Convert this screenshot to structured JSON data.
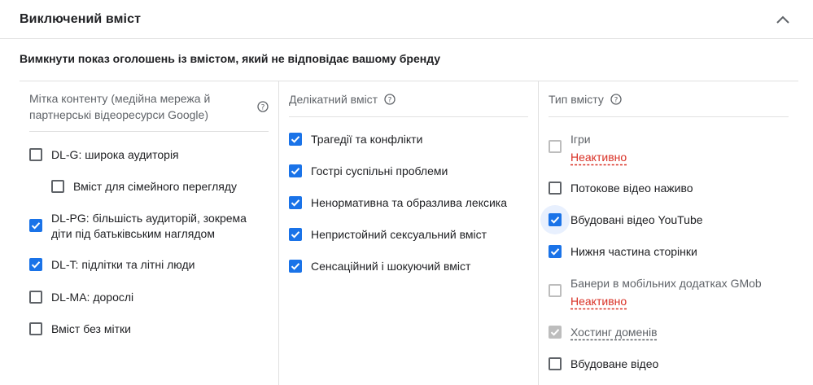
{
  "header": {
    "title": "Виключений вміст",
    "collapse_icon": "chevron-up-icon"
  },
  "subtitle": "Вимкнути показ оголошень із вмістом, який не відповідає вашому бренду",
  "columns": [
    {
      "heading": "Мітка контенту (медійна мережа й партнерські відеоресурси Google)",
      "items": [
        {
          "label": "DL-G: широка аудиторія",
          "checked": false
        },
        {
          "label": "Вміст для сімейного перегляду",
          "checked": false
        },
        {
          "label": "DL-PG: більшість аудиторій, зокрема діти під батьківським наглядом",
          "checked": true
        },
        {
          "label": "DL-T: підлітки та літні люди",
          "checked": true
        },
        {
          "label": "DL-MA: дорослі",
          "checked": false
        },
        {
          "label": "Вміст без мітки",
          "checked": false
        }
      ]
    },
    {
      "heading": "Делікатний вміст",
      "items": [
        {
          "label": "Трагедії та конфлікти",
          "checked": true
        },
        {
          "label": "Гострі суспільні проблеми",
          "checked": true
        },
        {
          "label": "Ненормативна та образлива лексика",
          "checked": true
        },
        {
          "label": "Непристойний сексуальний вміст",
          "checked": true
        },
        {
          "label": "Сенсаційний і шокуючий вміст",
          "checked": true
        }
      ]
    },
    {
      "heading": "Тип вмісту",
      "items": [
        {
          "label": "Ігри",
          "checked": false,
          "disabled": true,
          "status": "Неактивно"
        },
        {
          "label": "Потокове відео наживо",
          "checked": false
        },
        {
          "label": "Вбудовані відео YouTube",
          "checked": true,
          "focused": true
        },
        {
          "label": "Нижня частина сторінки",
          "checked": true
        },
        {
          "label": "Банери в мобільних додатках GMob",
          "checked": false,
          "disabled": true,
          "status": "Неактивно"
        },
        {
          "label": "Хостинг доменів",
          "checked": true,
          "disabled": true
        },
        {
          "label": "Вбудоване відео",
          "checked": false
        }
      ]
    }
  ],
  "colors": {
    "accent": "#1a73e8",
    "inactive_status": "#d93025",
    "border": "#e0e0e0"
  }
}
